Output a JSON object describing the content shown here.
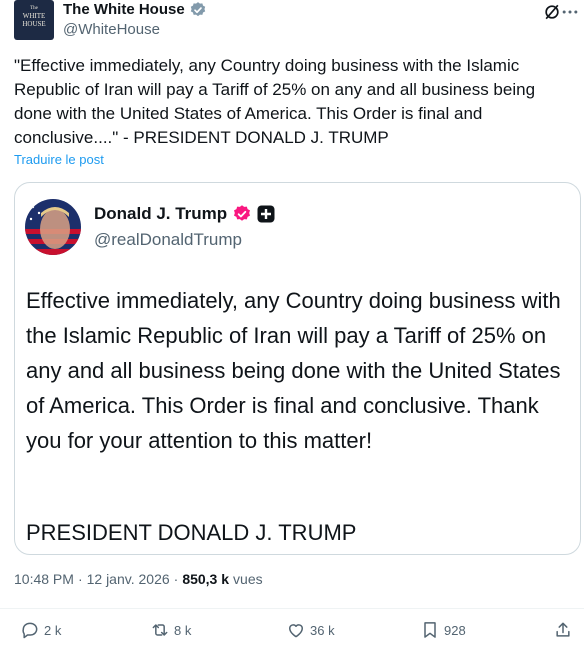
{
  "account": {
    "name": "The White House",
    "handle": "@WhiteHouse",
    "avatar_text_top": "The",
    "avatar_text_mid": "WHITE",
    "avatar_text_bot": "HOUSE"
  },
  "post": {
    "text": "\"Effective immediately, any Country doing business with the Islamic Republic of Iran will pay a Tariff of 25% on any and all business being done with the United States of America. This Order is final and conclusive....\" - PRESIDENT DONALD J. TRUMP",
    "translate_label": "Traduire le post"
  },
  "quote": {
    "name": "Donald J. Trump",
    "handle": "@realDonaldTrump",
    "text": "Effective immediately, any Country doing business with the Islamic Republic of Iran will pay a Tariff of 25% on any and all business being done with the United States of America. This Order is final and conclusive. Thank you for your attention to this matter!",
    "signature": "PRESIDENT DONALD J. TRUMP"
  },
  "meta": {
    "time": "10:48 PM",
    "separator": "·",
    "date": "12 janv. 2026",
    "views_count": "850,3 k",
    "views_label": "vues"
  },
  "actions": {
    "replies": "2 k",
    "reposts": "8 k",
    "likes": "36 k",
    "bookmarks": "928"
  },
  "colors": {
    "accent": "#1d9bf0",
    "verified_gold": "#829aab",
    "verified_pink": "#f91880",
    "muted": "#536471"
  },
  "icons": [
    "grok-icon",
    "more-icon",
    "verified-badge-icon",
    "affiliate-badge-icon",
    "reply-icon",
    "repost-icon",
    "like-icon",
    "bookmark-icon",
    "share-icon"
  ]
}
